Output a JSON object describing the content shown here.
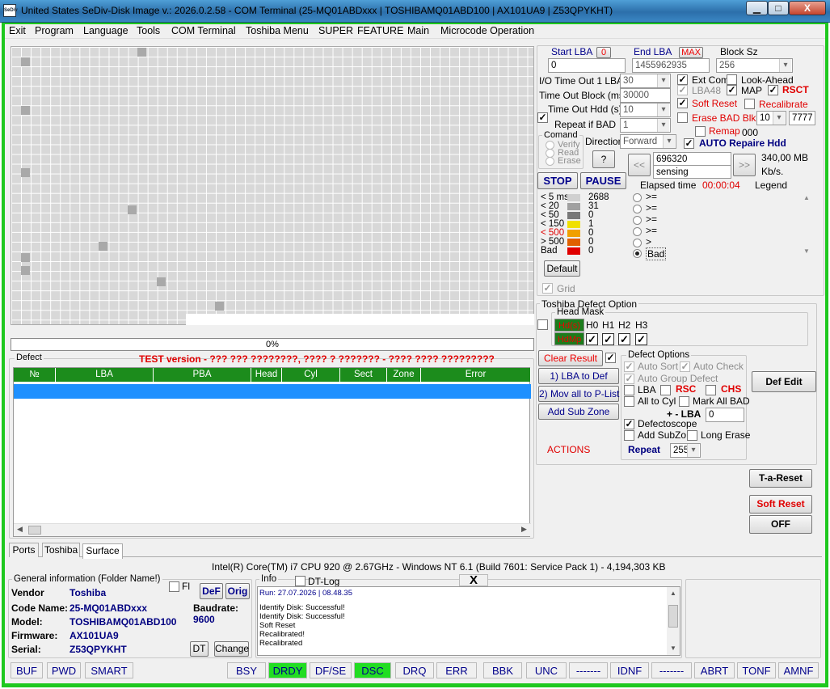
{
  "window": {
    "title": "United States  SeDiv-Disk Image v.: 2026.0.2.58 - COM Terminal  (25-MQ01ABDxxx | TOSHIBAMQ01ABD100 | AX101UA9 | Z53QPYKHT)",
    "logo_text": "SeDiv",
    "minimize": "▁",
    "maximize": "□",
    "close": "X"
  },
  "menu": [
    "Exit",
    "Program",
    "Language",
    "Tools",
    "COM Terminal",
    "Toshiba Menu",
    "SUPER",
    "FEATURE",
    "Main",
    "Microcode Operation"
  ],
  "surface": {
    "progress_text": "0%"
  },
  "defect": {
    "label": "Defect",
    "test_version_text": "TEST version - ??? ??? ????????, ???? ? ??????? - ???? ???? ?????????",
    "columns": [
      "№",
      "LBA",
      "PBA",
      "Head",
      "Cyl",
      "Sect",
      "Zone",
      "Error"
    ]
  },
  "lba": {
    "start_label": "Start LBA",
    "start_zero_btn": "0",
    "start_value": "0",
    "end_label": "End LBA",
    "end_max_btn": "MAX",
    "end_value": "1455962935",
    "block_label": "Block Sz",
    "block_value": "256"
  },
  "timeouts": {
    "io_label": "I/O Time Out 1 LBA",
    "io_value": "30",
    "block_label": "Time Out Block (ms)",
    "block_value": "30000",
    "hdd_label": "Time Out Hdd (s)",
    "hdd_value": "10",
    "repeat_label": "Repeat if BAD",
    "repeat_value": "1"
  },
  "options": {
    "ext_com": "Ext Com",
    "look_ahead": "Look-Ahead",
    "lba48": "LBA48",
    "map": "MAP",
    "rsct": "RSCT",
    "soft_reset": "Soft Reset",
    "recalibrate": "Recalibrate",
    "erase_bad": "Erase BAD Blk",
    "erase_count": "10",
    "erase_pattern": "7777",
    "remap": "Remap",
    "remap_value": "000",
    "auto_repair": "AUTO Repaire Hdd"
  },
  "command": {
    "label": "Comand",
    "verify": "Verify",
    "read": "Read",
    "erase": "Erase",
    "direction_label": "Direction",
    "direction_value": "Forward",
    "help_btn": "?"
  },
  "scan": {
    "prev_btn": "<<",
    "next_btn": ">>",
    "position_value": "696320",
    "status_value": "sensing",
    "size_text": "340,00 MB",
    "speed_unit": "Kb/s.",
    "elapsed_label": "Elapsed time",
    "elapsed_value": "00:00:04",
    "legend_label": "Legend",
    "stop_btn": "STOP",
    "pause_btn": "PAUSE"
  },
  "timing": [
    {
      "label": "< 5 ms",
      "count": "2688",
      "color": "#d0d0d0"
    },
    {
      "label": "< 20",
      "count": "31",
      "color": "#a0a0a0"
    },
    {
      "label": "< 50",
      "count": "0",
      "color": "#787878"
    },
    {
      "label": "< 150",
      "count": "1",
      "color": "#f0e000"
    },
    {
      "label": "< 500",
      "count": "0",
      "color": "#f0a000"
    },
    {
      "label": "> 500",
      "count": "0",
      "color": "#e06000"
    },
    {
      "label": "Bad",
      "count": "0",
      "color": "#e00000"
    }
  ],
  "legend_items": [
    ">=",
    ">=",
    ">=",
    ">=",
    ">",
    "Bad"
  ],
  "default_btn": "Default",
  "grid_label": "Grid",
  "toshiba": {
    "label": "Toshiba Defect Option",
    "head_mask_label": "Head Mask",
    "hd_label": "Hd(s)",
    "hdmp_label": "HdMp",
    "heads": [
      "H0",
      "H1",
      "H2",
      "H3"
    ],
    "clear_result": "Clear Result",
    "lba_to_def": "1) LBA to Def",
    "mov_all": "2) Mov all to P-List",
    "add_sub_zone": "Add Sub Zone",
    "actions": "ACTIONS",
    "defect_options_label": "Defect Options",
    "auto_sort": "Auto Sort",
    "auto_check": "Auto Check",
    "auto_group": "Auto Group Defect",
    "lba": "LBA",
    "rsc": "RSC",
    "chs": "CHS",
    "all_to_cyl": "All to Cyl",
    "mark_all_bad": "Mark All BAD",
    "plus_minus_lba": "+ - LBA",
    "plus_minus_value": "0",
    "defectoscope": "Defectoscope",
    "add_subzo": "Add SubZo",
    "long_erase": "Long Erase",
    "repeat_label": "Repeat",
    "repeat_value": "255"
  },
  "right_buttons": {
    "def_edit": "Def Edit",
    "ta_reset": "T-a-Reset",
    "soft_reset": "Soft Reset",
    "off": "OFF"
  },
  "tabs": [
    "Ports",
    "Toshiba",
    "Surface"
  ],
  "system_info": "Intel(R) Core(TM) i7 CPU 920  @ 2.67GHz - Windows NT 6.1 (Build 7601: Service Pack 1) -  4,194,303 KB",
  "general": {
    "label": "General information (Folder Name!)",
    "fl": "Fl",
    "def_btn": "DeF",
    "orig_btn": "Orig",
    "vendor_label": "Vendor",
    "vendor": "Toshiba",
    "code_label": "Code Name:",
    "code": "25-MQ01ABDxxx",
    "model_label": "Model:",
    "model": "TOSHIBAMQ01ABD100",
    "firmware_label": "Firmware:",
    "firmware": "AX101UA9",
    "serial_label": "Serial:",
    "serial": "Z53QPYKHT",
    "baud_label": "Baudrate:",
    "baud": "9600",
    "dt_btn": "DT",
    "change_btn": "Change"
  },
  "info": {
    "label": "Info",
    "dt_log": "DT-Log",
    "close": "X",
    "run_line": "Run: 27.07.2026  | 08.48.35",
    "lines": [
      "Identify Disk: Successful!",
      "Identify Disk: Successful!",
      "Soft Reset",
      "Recalibrated!",
      "Recalibrated"
    ]
  },
  "status": [
    "BUF",
    "PWD",
    "SMART",
    "BSY",
    "DRDY",
    "DF/SE",
    "DSC",
    "DRQ",
    "ERR",
    "BBK",
    "UNC",
    "-------",
    "IDNF",
    "-------",
    "ABRT",
    "TONF",
    "AMNF"
  ],
  "colors": {
    "frame": "#1ec81e",
    "header_green": "#1c8c1c",
    "selected_row": "#1e90ff",
    "active_status": "#22dd22"
  }
}
